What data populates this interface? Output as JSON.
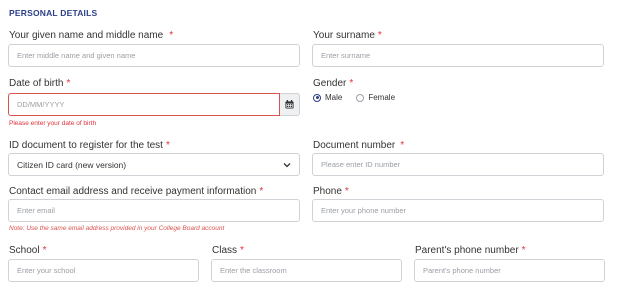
{
  "section": {
    "title": "PERSONAL DETAILS"
  },
  "given_name": {
    "label": "Your given name and middle name",
    "placeholder": "Enter middle name and given name"
  },
  "surname": {
    "label": "Your surname",
    "placeholder": "Enter surname"
  },
  "dob": {
    "label": "Date of birth",
    "placeholder": "DD/MM/YYYY",
    "error": "Please enter your date of birth",
    "icon": "calendar-icon"
  },
  "gender": {
    "label": "Gender",
    "options": [
      "Male",
      "Female"
    ],
    "selected": "Male"
  },
  "id_document": {
    "label": "ID document to register for the test",
    "value": "Citizen ID card (new version)",
    "icon": "chevron-down-icon"
  },
  "document_number": {
    "label": "Document number",
    "placeholder": "Please enter ID number"
  },
  "email": {
    "label": "Contact email address and receive payment information",
    "placeholder": "Enter email",
    "note": "Note: Use the same email address provided in your College Board account"
  },
  "phone": {
    "label": "Phone",
    "placeholder": "Enter your phone number"
  },
  "school": {
    "label": "School",
    "placeholder": "Enter your school"
  },
  "class": {
    "label": "Class",
    "placeholder": "Enter the classroom"
  },
  "parent_phone": {
    "label": "Parent's phone number",
    "placeholder": "Parent's phone number"
  },
  "required_mark": "*",
  "colors": {
    "accent": "#2c3f8a",
    "required": "#e0303c",
    "error_border": "#d9534f"
  }
}
